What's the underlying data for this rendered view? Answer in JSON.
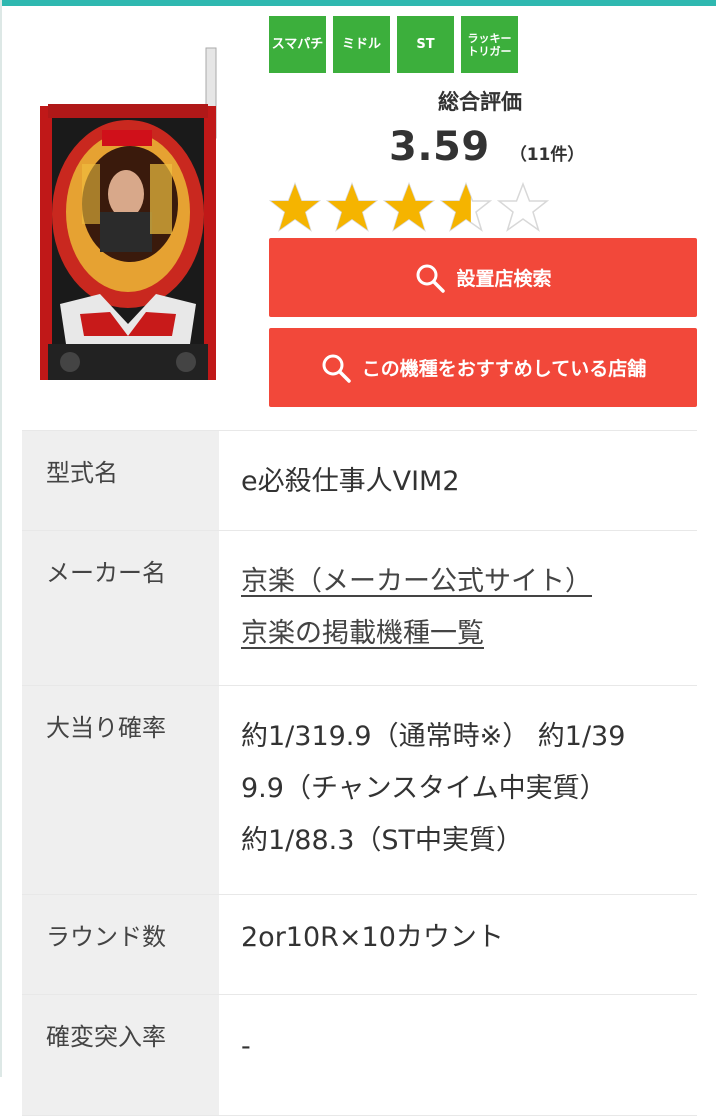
{
  "tags": [
    "スマパチ",
    "ミドル",
    "ST",
    "ラッキートリガー"
  ],
  "rating": {
    "title": "総合評価",
    "score": "3.59",
    "count": "（11件）",
    "stars_value": 3.59,
    "stars_max": 5
  },
  "buttons": {
    "search_store": "設置店検索",
    "recommend_store": "この機種をおすすめしている店舗"
  },
  "spec": {
    "model_label": "型式名",
    "model_value": "e必殺仕事人VIM2",
    "maker_label": "メーカー名",
    "maker_link1": "京楽（メーカー公式サイト）",
    "maker_link2": "京楽の掲載機種一覧",
    "prob_label": "大当り確率",
    "prob_line1": "約1/319.9（通常時※） 約1/39",
    "prob_line2": "9.9（チャンスタイム中実質）",
    "prob_line3": "約1/88.3（ST中実質）",
    "round_label": "ラウンド数",
    "round_value": "2or10R×10カウント",
    "kakuhen_label": "確変突入率",
    "kakuhen_value": "-"
  },
  "colors": {
    "accent": "#2fb8b0",
    "tag_green": "#3caf3c",
    "button_red": "#f2483a",
    "star_gold": "#f5b400"
  }
}
